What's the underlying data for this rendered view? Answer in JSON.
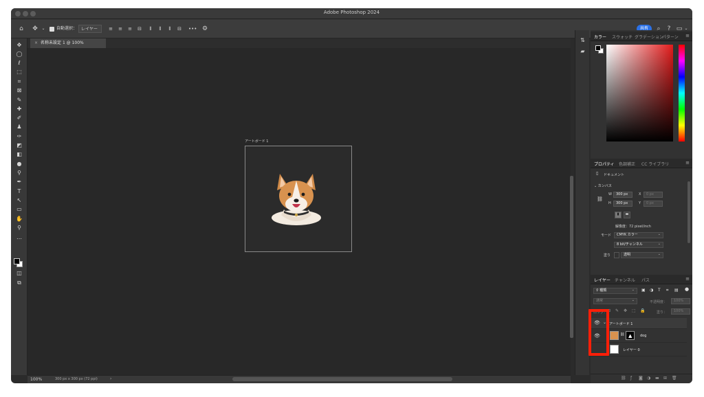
{
  "window": {
    "title": "Adobe Photoshop 2024"
  },
  "options": {
    "auto_select_label": "自動選択：",
    "auto_select_value": "レイヤー",
    "more": "•••",
    "share": "共有"
  },
  "document": {
    "tab_title": "名称未設定 1 @ 100% (CMYK/8#) *",
    "artboard_label": "アートボード 1"
  },
  "status": {
    "zoom": "100%",
    "info": "300 px x 300 px (72 ppi)"
  },
  "color_panel": {
    "tabs": [
      "カラー",
      "スウォッチ",
      "グラデーション",
      "パターン"
    ]
  },
  "properties": {
    "tabs": [
      "プロパティ",
      "色調補正",
      "CC ライブラリ"
    ],
    "section": "ドキュメント",
    "canvas_label": "カンバス",
    "w_label": "W",
    "w_value": "300 px",
    "h_label": "H",
    "h_value": "300 px",
    "x_label": "X",
    "x_value": "0 px",
    "y_label": "Y",
    "y_value": "0 px",
    "resolution": "解像度：72 pixel/inch",
    "mode_label": "モード",
    "mode_value": "CMYK カラー",
    "depth_value": "8 bit/チャンネル",
    "fill_label": "塗り",
    "fill_value": "透明"
  },
  "layers_panel": {
    "tabs": [
      "レイヤー",
      "チャンネル",
      "パス"
    ],
    "kind_filter": "種類",
    "blend_mode": "通常",
    "opacity_label": "不透明度：",
    "opacity_value": "100%",
    "lock_label": "ロック：",
    "fill_label": "塗り：",
    "fill_value": "100%",
    "layers": [
      {
        "name": "アートボード 1",
        "type": "group",
        "visible": true
      },
      {
        "name": "dog",
        "type": "masked-layer",
        "visible": true
      },
      {
        "name": "レイヤー 0",
        "type": "layer",
        "visible": false
      }
    ]
  },
  "highlight_color": "#ff1f08"
}
